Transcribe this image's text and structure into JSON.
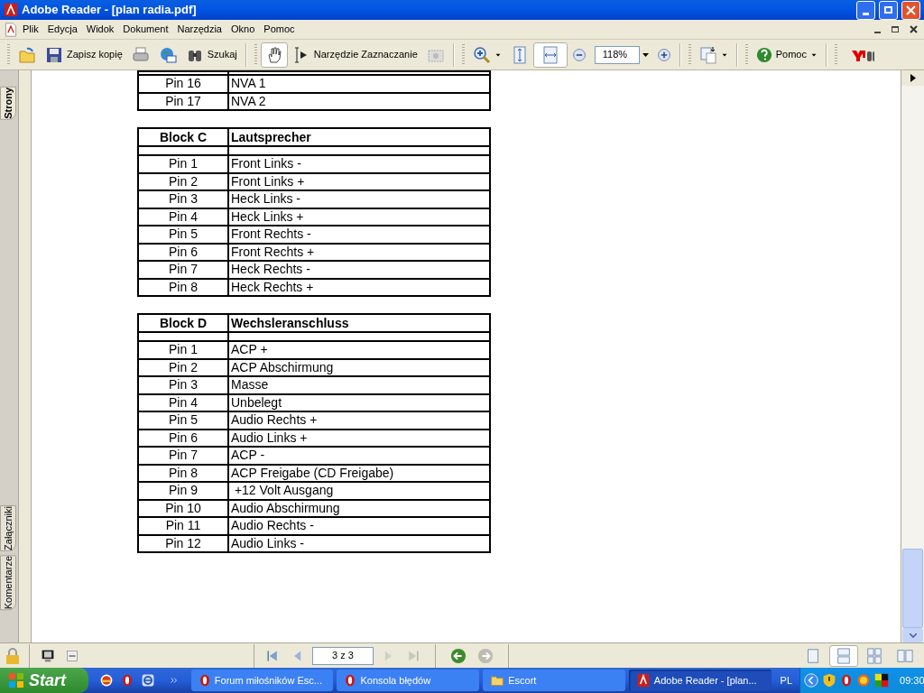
{
  "window": {
    "title": "Adobe Reader - [plan radia.pdf]"
  },
  "menu": [
    "Plik",
    "Edycja",
    "Widok",
    "Dokument",
    "Narzędzia",
    "Okno",
    "Pomoc"
  ],
  "toolbar": {
    "save_copy": "Zapisz kopię",
    "search": "Szukaj",
    "select_tool": "Narzędzie Zaznaczanie",
    "zoom": "118%",
    "help": "Pomoc",
    "hand_selected": true,
    "fit_width_selected": true
  },
  "side_tabs": [
    {
      "label": "Strony",
      "selected": true
    },
    {
      "label": "Załączniki",
      "selected": false
    },
    {
      "label": "Komentarze",
      "selected": false
    }
  ],
  "tables": [
    {
      "rows": [
        [
          "Pin 16",
          "NVA 1"
        ],
        [
          "Pin 17",
          "NVA 2"
        ]
      ]
    },
    {
      "header": [
        "Block C",
        "Lautsprecher"
      ],
      "rows": [
        [
          "Pin 1",
          "Front Links -"
        ],
        [
          "Pin 2",
          "Front Links +"
        ],
        [
          "Pin 3",
          "Heck Links -"
        ],
        [
          "Pin 4",
          "Heck Links +"
        ],
        [
          "Pin 5",
          "Front Rechts -"
        ],
        [
          "Pin 6",
          "Front Rechts +"
        ],
        [
          "Pin 7",
          "Heck Rechts -"
        ],
        [
          "Pin 8",
          "Heck Rechts +"
        ]
      ]
    },
    {
      "header": [
        "Block D",
        "Wechsleranschluss"
      ],
      "rows": [
        [
          "Pin 1",
          "ACP +"
        ],
        [
          "Pin 2",
          "ACP Abschirmung"
        ],
        [
          "Pin 3",
          "Masse"
        ],
        [
          "Pin 4",
          "Unbelegt"
        ],
        [
          "Pin 5",
          "Audio Rechts +"
        ],
        [
          "Pin 6",
          "Audio Links +"
        ],
        [
          "Pin 7",
          "ACP -"
        ],
        [
          "Pin 8",
          "ACP Freigabe (CD Freigabe)"
        ],
        [
          "Pin 9",
          " +12 Volt Ausgang"
        ],
        [
          "Pin 10",
          "Audio Abschirmung"
        ],
        [
          "Pin 11",
          "Audio Rechts -"
        ],
        [
          "Pin 12",
          "Audio Links -"
        ]
      ]
    }
  ],
  "status_bar": {
    "page": "3 z 3",
    "views": [
      {
        "selected": false
      },
      {
        "selected": true
      },
      {
        "selected": false
      },
      {
        "selected": false
      }
    ]
  },
  "taskbar": {
    "start": "Start",
    "tasks": [
      {
        "label": "Forum miłośników Esc...",
        "kind": "opera",
        "selected": false
      },
      {
        "label": "Konsola błędów",
        "kind": "opera",
        "selected": false
      },
      {
        "label": "Escort",
        "kind": "folder",
        "selected": false
      },
      {
        "label": "Adobe Reader - [plan...",
        "kind": "reader",
        "selected": true
      }
    ],
    "language": "PL",
    "clock": "09:30"
  }
}
